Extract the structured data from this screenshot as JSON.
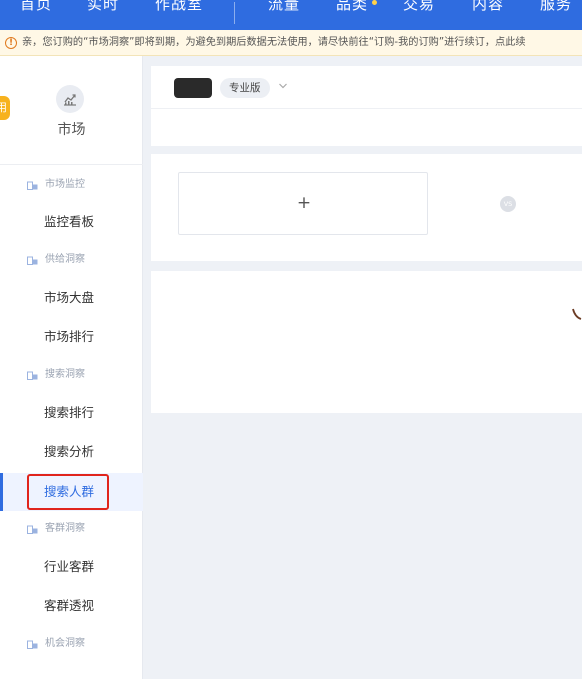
{
  "topnav": {
    "items": [
      "首页",
      "实时",
      "作战室",
      "流量",
      "品类",
      "交易",
      "内容",
      "服务"
    ]
  },
  "notice": {
    "text": "亲，您订购的“市场洞察”即将到期，为避免到期后数据无法使用，请尽快前往“订购-我的订购”进行续订，点此续"
  },
  "sidebar": {
    "tab_label": "用",
    "title": "市场",
    "groups": [
      {
        "label": "市场监控",
        "items": [
          "监控看板"
        ]
      },
      {
        "label": "供给洞察",
        "items": [
          "市场大盘",
          "市场排行"
        ]
      },
      {
        "label": "搜索洞察",
        "items": [
          "搜索排行",
          "搜索分析",
          "搜索人群"
        ]
      },
      {
        "label": "客群洞察",
        "items": [
          "行业客群",
          "客群透视"
        ]
      },
      {
        "label": "机会洞察",
        "items": []
      }
    ],
    "active_item": "搜索人群"
  },
  "main": {
    "edition_badge": "专业版",
    "add_symbol": "+",
    "vs_label": "VS"
  },
  "colors": {
    "brand": "#2f6ce0",
    "highlight": "#e0241c",
    "tab": "#f7b21e"
  }
}
